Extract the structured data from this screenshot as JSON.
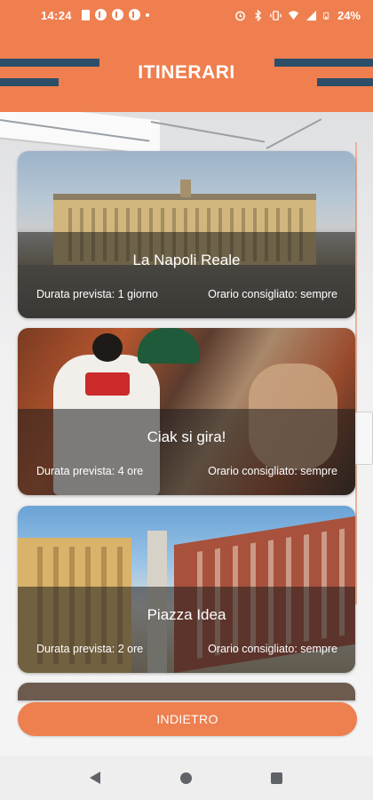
{
  "status_bar": {
    "time": "14:24",
    "battery": "24%",
    "left_icons": [
      "sim-icon",
      "facebook-icon",
      "facebook-icon",
      "whatsapp-icon",
      "dot-icon"
    ],
    "right_icons": [
      "alarm-icon",
      "bluetooth-icon",
      "vibrate-icon",
      "wifi-icon",
      "signal-icon",
      "battery-icon"
    ]
  },
  "header": {
    "title": "ITINERARI"
  },
  "itineraries": [
    {
      "title": "La Napoli Reale",
      "duration": "Durata prevista: 1 giorno",
      "time": "Orario consigliato: sempre"
    },
    {
      "title": "Ciak si gira!",
      "duration": "Durata prevista: 4 ore",
      "time": "Orario consigliato: sempre"
    },
    {
      "title": "Piazza Idea",
      "duration": "Durata prevista: 2 ore",
      "time": "Orario consigliato: sempre"
    }
  ],
  "footer": {
    "back_label": "INDIETRO"
  },
  "colors": {
    "accent": "#ef7f4f",
    "stripe": "#2c4e68"
  }
}
